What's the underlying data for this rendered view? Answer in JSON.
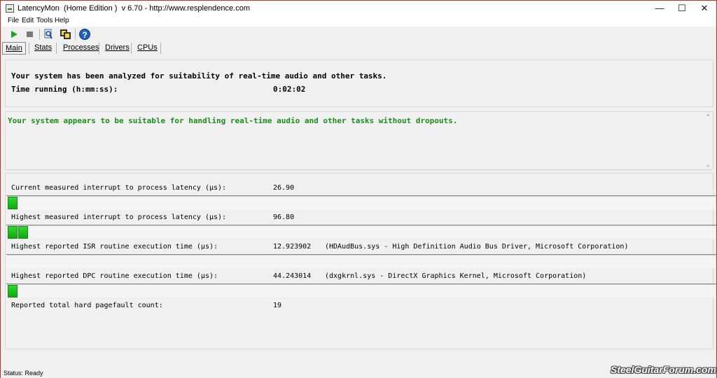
{
  "window": {
    "title": "LatencyMon  (Home Edition )  v 6.70 - http://www.resplendence.com",
    "minimize": "—",
    "maximize": "☐",
    "close": "✕"
  },
  "menu": [
    "File",
    "Edit",
    "Tools",
    "Help"
  ],
  "toolbar": {
    "icons": [
      "play-icon",
      "stop-icon",
      "search-icon",
      "copy-icon",
      "help-icon"
    ],
    "help_glyph": "?"
  },
  "tabs": [
    {
      "label": "Main",
      "active": true
    },
    {
      "label": "Stats",
      "active": false
    },
    {
      "label": "Processes",
      "active": false
    },
    {
      "label": "Drivers",
      "active": false
    },
    {
      "label": "CPUs",
      "active": false
    }
  ],
  "summary": {
    "analyzed_text": "Your system has been analyzed for suitability of real-time audio and other tasks.",
    "time_label": "Time running (h:mm:ss):",
    "time_value": "0:02:02"
  },
  "verdict": {
    "text": "Your system appears to be suitable for handling real-time audio and other tasks without dropouts.",
    "color": "#1a8f1a"
  },
  "metrics": [
    {
      "label": "Current measured interrupt to process latency (µs):",
      "value": "26.90",
      "desc": "",
      "bar_segments": 1
    },
    {
      "label": "Highest measured interrupt to process latency (µs):",
      "value": "96.80",
      "desc": "",
      "bar_segments": 2
    },
    {
      "label": "Highest reported ISR routine execution time (µs):",
      "value": "12.923902",
      "desc": "(HDAudBus.sys - High Definition Audio Bus Driver, Microsoft Corporation)",
      "bar_segments": 0
    },
    {
      "label": "Highest reported DPC routine execution time (µs):",
      "value": "44.243014",
      "desc": "(dxgkrnl.sys - DirectX Graphics Kernel, Microsoft Corporation)",
      "bar_segments": 1
    },
    {
      "label": "Reported total hard pagefault count:",
      "value": "19",
      "desc": "",
      "bar_segments": null
    }
  ],
  "status": {
    "text": "Status: Ready"
  },
  "watermark": "SteelGuitarForum.com",
  "colors": {
    "bar_green": "#1fc01f",
    "window_border": "#c9302c",
    "accent_blue": "#1f5fbf"
  }
}
